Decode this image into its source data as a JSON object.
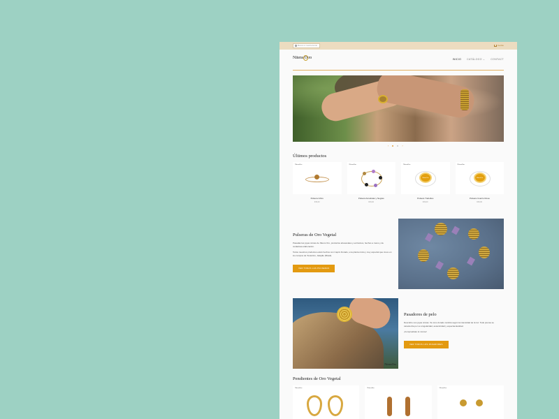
{
  "colors": {
    "page_bg": "#9dd1c3",
    "accent": "#e39a10",
    "topbar": "#ecdcc0"
  },
  "topbar": {
    "search_placeholder": "Buscar en nuestra tienda",
    "cart_label": "Carrito"
  },
  "header": {
    "logo_prefix": "Nitens",
    "logo_o": "O",
    "logo_suffix": "ro",
    "nav": [
      "INICIO",
      "CATÁLOGO ⌄",
      "CONTACT"
    ]
  },
  "hero": {
    "slider_prev": "‹",
    "slider_next": "›"
  },
  "latest": {
    "title": "Últimos productos",
    "products": [
      {
        "name": "Pulsera Ixhiro",
        "price": "€39,00",
        "brand": "NitensOro"
      },
      {
        "name": "Pulsera Amatistas y Negras",
        "price": "€39,00",
        "brand": "NitensOro"
      },
      {
        "name": "Pulsera Trebolles",
        "price": "€39,00",
        "brand": "NitensOro"
      },
      {
        "name": "Pulsera Cuarzo Rosa",
        "price": "€39,00",
        "brand": "NitensOro"
      }
    ],
    "badge": "NitensOro"
  },
  "feature1": {
    "title": "Pulseras de Oro Vegetal",
    "p1": "Pasadas las joyas únicas de Nitens Oro, productos artesanales y exclusivos, hechos a mano y de cuidadosa elaboración.",
    "p2": "Todos nuestros productos están hechos con Capim Dorado, una planta única y muy especial que crece en los campos de Tocantins, Jalapão (Brasil).",
    "button": "VER TODAS LAS PULSERAS"
  },
  "feature2": {
    "title": "Pasadores de pelo",
    "p1": "Descubre sus joyas únicas. Su tono dorado cambia según la intensidad de la luz. Todo piensa se caracteriza por su singularidad, autenticidad y espectacularidad.",
    "p2": "¡Compruébalo tú mismo!",
    "button": "VER TODOS LOS PASADORES",
    "image_logo": "NitensOro"
  },
  "earrings": {
    "title": "Pendientes de Oro Vegetal",
    "brand": "NitensOro"
  }
}
